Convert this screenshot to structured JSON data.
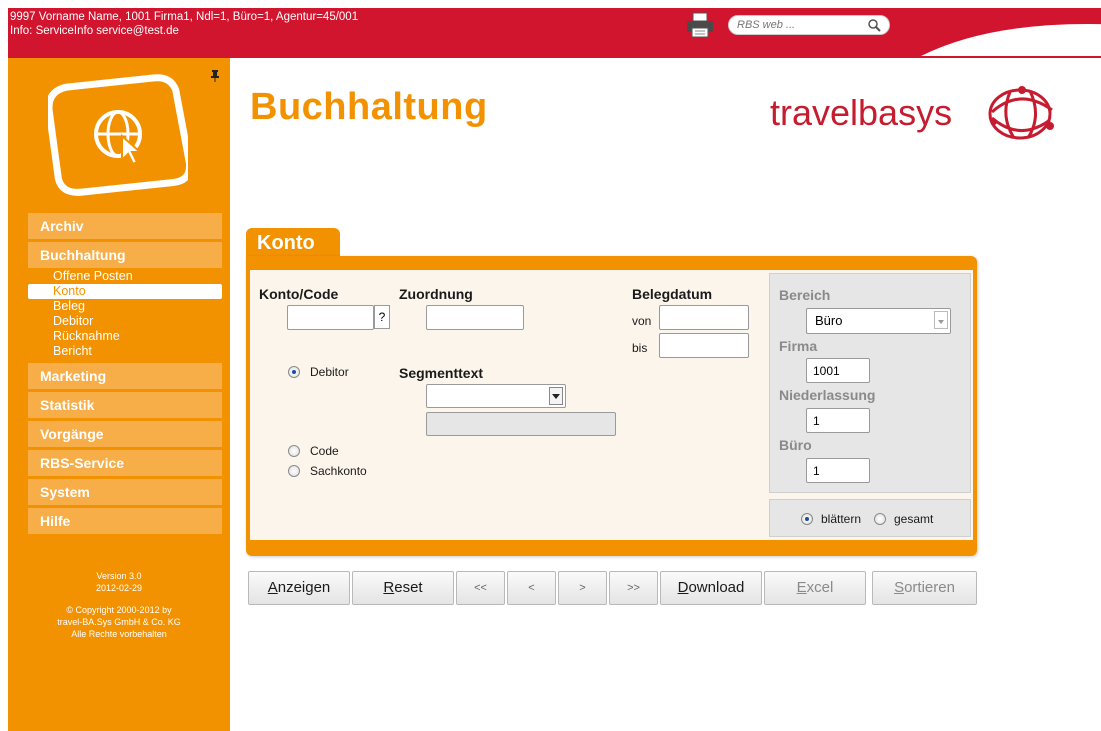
{
  "topbar": {
    "line1": "9997 Vorname Name, 1001 Firma1, Ndl=1, Büro=1, Agentur=45/001",
    "line2": "Info: ServiceInfo service@test.de",
    "search_placeholder": "RBS web ...",
    "icons": [
      "printer-icon",
      "search-icon"
    ]
  },
  "sidebar": {
    "items": [
      {
        "label": "Archiv"
      },
      {
        "label": "Buchhaltung"
      },
      {
        "label": "Marketing"
      },
      {
        "label": "Statistik"
      },
      {
        "label": "Vorgänge"
      },
      {
        "label": "RBS-Service"
      },
      {
        "label": "System"
      },
      {
        "label": "Hilfe"
      }
    ],
    "subitems": [
      {
        "label": "Offene Posten"
      },
      {
        "label": "Konto"
      },
      {
        "label": "Beleg"
      },
      {
        "label": "Debitor"
      },
      {
        "label": "Rücknahme"
      },
      {
        "label": "Bericht"
      }
    ],
    "active_subitem": "Konto",
    "version": "Version 3.0",
    "date": "2012-02-29",
    "copyright1": "© Copyright 2000-2012 by",
    "copyright2": "travel-BA.Sys GmbH & Co. KG",
    "copyright3": "Alle Rechte vorbehalten"
  },
  "header": {
    "title": "Buchhaltung",
    "brand_travel": "travel",
    "brand_basys": "basys"
  },
  "form": {
    "tab_label": "Konto",
    "konto_code_label": "Konto/Code",
    "konto_code_value": "",
    "lookup_button": "?",
    "zuordnung_label": "Zuordnung",
    "zuordnung_value": "",
    "belegdatum_label": "Belegdatum",
    "von_label": "von",
    "bis_label": "bis",
    "von_value": "",
    "bis_value": "",
    "segmenttext_label": "Segmenttext",
    "segmenttext_value": "",
    "radio_debitor": "Debitor",
    "radio_code": "Code",
    "radio_sachkonto": "Sachkonto",
    "selected_type": "Debitor",
    "bereich_label": "Bereich",
    "bereich_value": "Büro",
    "firma_label": "Firma",
    "firma_value": "1001",
    "niederlassung_label": "Niederlassung",
    "niederlassung_value": "1",
    "buero_label": "Büro",
    "buero_value": "1",
    "radio_blaettern": "blättern",
    "radio_gesamt": "gesamt",
    "selected_paging": "blättern"
  },
  "buttons": {
    "anzeigen_first": "A",
    "anzeigen_rest": "nzeigen",
    "reset_first": "R",
    "reset_rest": "eset",
    "first": "<<",
    "prev": "<",
    "next": ">",
    "last": ">>",
    "download_first": "D",
    "download_rest": "ownload",
    "excel_first": "E",
    "excel_rest": "xcel",
    "sortieren_first": "S",
    "sortieren_rest": "ortieren"
  },
  "colors": {
    "topbar": "#d2152f",
    "sidebar": "#f39200",
    "accent": "#f39200",
    "brand_red": "#c61c30"
  }
}
